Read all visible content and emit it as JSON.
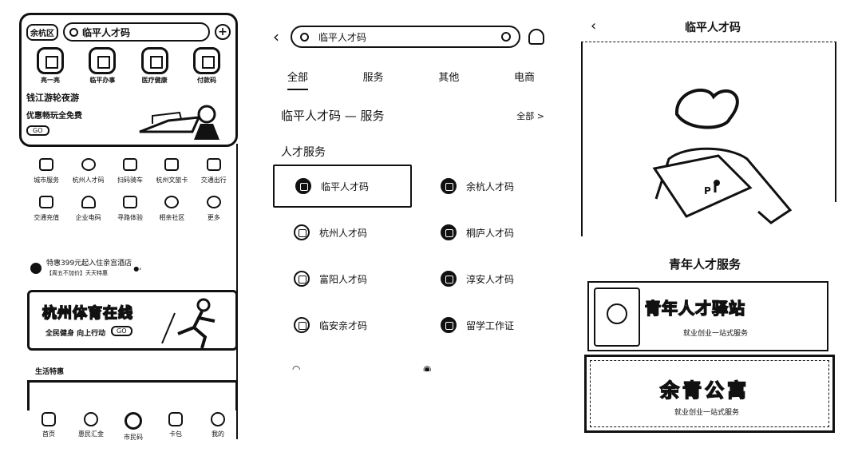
{
  "panel1": {
    "city": "余杭区",
    "search_text": "临平人才码",
    "quick": [
      "亮一亮",
      "临平办事",
      "医疗健康",
      "付款码"
    ],
    "banner1": {
      "title": "钱江游轮夜游",
      "title2": "优惠畅玩全免费",
      "badge": "GO"
    },
    "grid": [
      {
        "label": "城市服务",
        "icon": "city-icon"
      },
      {
        "label": "杭州人才码",
        "icon": "talent-icon"
      },
      {
        "label": "扫码骑车",
        "icon": "bike-icon"
      },
      {
        "label": "杭州文旅卡",
        "icon": "card-icon"
      },
      {
        "label": "交通出行",
        "icon": "bus-icon"
      },
      {
        "label": "交通充值",
        "icon": "recharge-icon"
      },
      {
        "label": "企业电码",
        "icon": "headset-icon"
      },
      {
        "label": "寻路体验",
        "icon": "home-icon"
      },
      {
        "label": "相亲社区",
        "icon": "community-icon"
      },
      {
        "label": "更多",
        "icon": "more-icon"
      }
    ],
    "notice": {
      "line1": "特惠399元起入住亲宫酒店",
      "line2": "【周五不加价】天天特惠"
    },
    "banner2": {
      "title": "杭州体育在线",
      "sub": "全民健身  向上行动",
      "btn": "GO"
    },
    "life_title": "生活特惠",
    "tabbar": [
      "首页",
      "惠民汇金",
      "市民码",
      "卡包",
      "我的"
    ]
  },
  "panel2": {
    "search_text": "临平人才码",
    "tabs": [
      "全部",
      "服务",
      "其他",
      "电商"
    ],
    "section_title": "临平人才码 — 服务",
    "section_all": "全部 >",
    "category": "人才服务",
    "services": [
      "临平人才码",
      "余杭人才码",
      "杭州人才码",
      "桐庐人才码",
      "富阳人才码",
      "淳安人才码",
      "临安亲才码",
      "留学工作证"
    ]
  },
  "panel3": {
    "title": "临平人才码",
    "subtitle": "青年人才服务",
    "card1": {
      "title": "青年人才驿站",
      "sub": "就业创业一站式服务"
    },
    "card2": {
      "title": "余青公寓",
      "sub": "就业创业一站式服务"
    }
  },
  "colors": {
    "ink": "#111111",
    "bg": "#ffffff"
  }
}
